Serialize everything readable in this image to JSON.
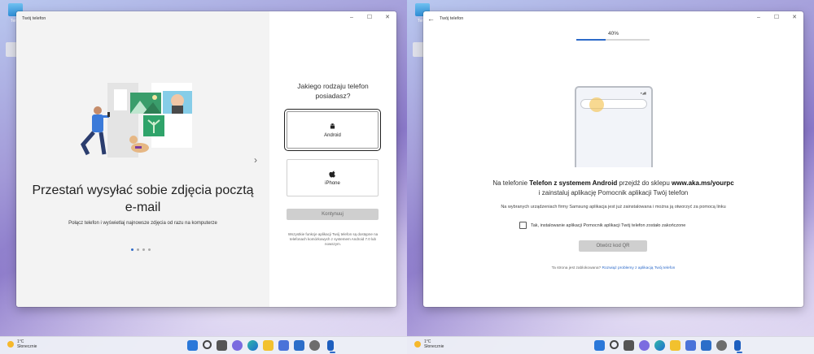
{
  "desktop": {
    "icon_label": "Ten k",
    "weather": {
      "temp": "1°C",
      "desc": "Słonecznie"
    }
  },
  "left_window": {
    "title": "Twój telefon",
    "controls": [
      "–",
      "☐",
      "✕"
    ],
    "headline_line1": "Przestań wysyłać sobie zdjęcia pocztą",
    "headline_line2": "e-mail",
    "subline": "Połącz telefon i wyświetlaj najnowsze zdjęcia od razu na komputerze",
    "question_line1": "Jakiego rodzaju telefon",
    "question_line2": "posiadasz?",
    "option_android": "Android",
    "option_iphone": "iPhone",
    "continue_label": "Kontynuuj",
    "note_line1": "Wszystkie funkcje aplikacji Twój telefon są dostępne na",
    "note_line2": "telefonach komórkowych z systemem Android 7.0 lub",
    "note_line3": "nowszym."
  },
  "right_window": {
    "title": "Twój telefon",
    "controls": [
      "–",
      "☐",
      "✕"
    ],
    "progress_text": "40%",
    "progress_value": 0.4,
    "instr_prefix": "Na telefonie ",
    "instr_bold1": "Telefon z systemem Android",
    "instr_mid": " przejdź do sklepu ",
    "instr_bold2": "www.aka.ms/yourpc",
    "instr_line2": "i zainstaluj aplikację Pomocnik aplikacji Twój telefon",
    "small_note": "Na wybranych urządzeniach firmy Samsung aplikacja jest już zainstalowana i można ją otworzyć za pomocą linku",
    "checkbox_label": "Tak, instalowanie aplikacji Pomocnik aplikacji Twój telefon zostało zakończone",
    "qr_button": "Otwórz kod QR",
    "help_prefix": "Ta strona jest zablokowana?",
    "help_link": "Rozwiąż problemy z aplikacją Twój telefon"
  },
  "colors": {
    "accent": "#2d6ac9",
    "disabled_button": "#cfcfcf",
    "pane_gray": "#f3f3f3"
  },
  "taskbar_icons": [
    "start-icon",
    "search-icon",
    "task-view-icon",
    "chat-icon",
    "edge-icon",
    "file-explorer-icon",
    "store-icon",
    "mail-icon",
    "settings-icon",
    "your-phone-icon"
  ]
}
